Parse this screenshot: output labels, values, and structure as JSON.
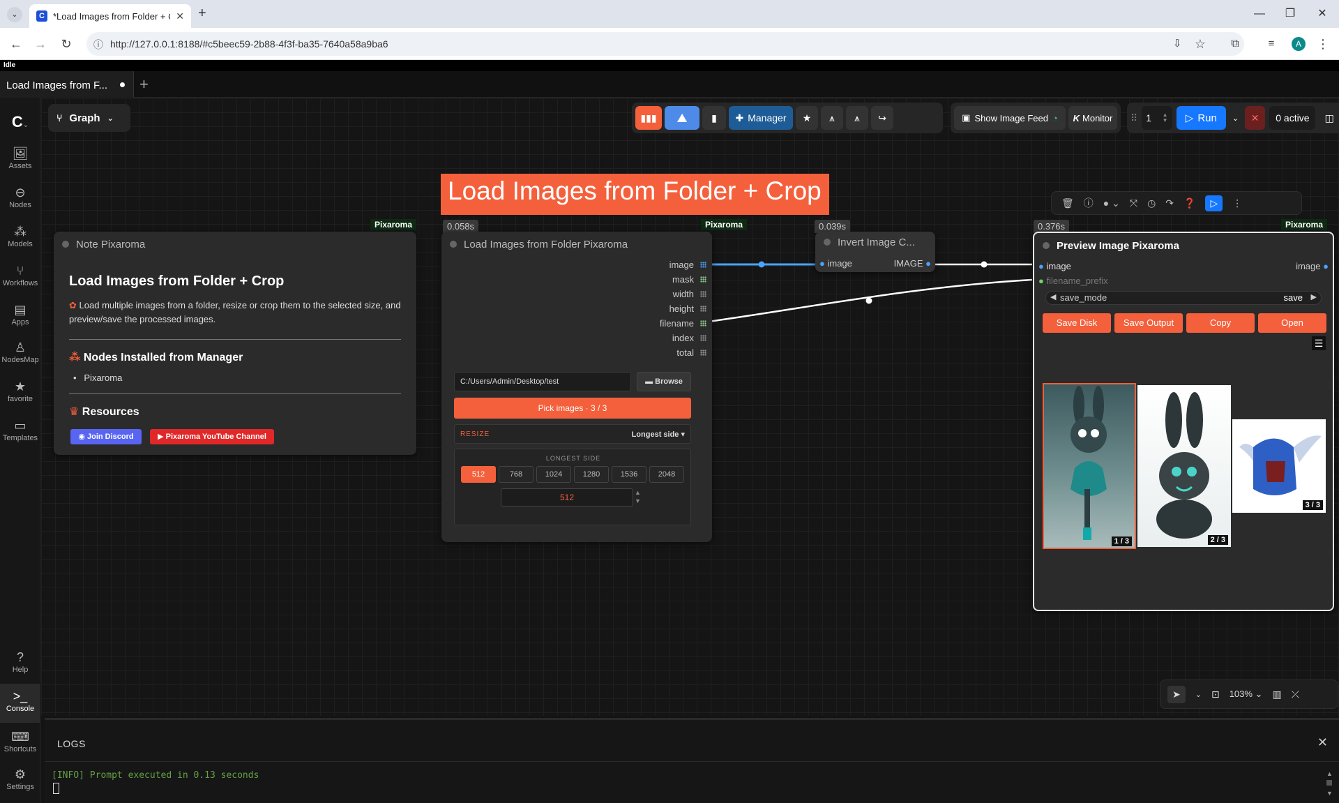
{
  "browser": {
    "tab_title": "*Load Images from Folder + Cr",
    "url": "http://127.0.0.1:8188/#c5beec59-2b88-4f3f-ba35-7640a58a9ba6",
    "profile_initial": "A"
  },
  "app": {
    "status": "Idle",
    "workflow_tab": "Load Images from F...",
    "graph_label": "Graph"
  },
  "sidebar": {
    "items": [
      {
        "label": "Assets",
        "icon": "image-icon"
      },
      {
        "label": "Nodes",
        "icon": "node-icon"
      },
      {
        "label": "Models",
        "icon": "models-icon"
      },
      {
        "label": "Workflows",
        "icon": "workflow-icon"
      },
      {
        "label": "Apps",
        "icon": "apps-icon"
      },
      {
        "label": "NodesMap",
        "icon": "nodesmap-icon"
      },
      {
        "label": "favorite",
        "icon": "star-icon"
      },
      {
        "label": "Templates",
        "icon": "templates-icon"
      }
    ],
    "bottom": [
      {
        "label": "Help",
        "icon": "help-icon"
      },
      {
        "label": "Console",
        "icon": "console-icon"
      },
      {
        "label": "Shortcuts",
        "icon": "keyboard-icon"
      },
      {
        "label": "Settings",
        "icon": "gear-icon"
      }
    ]
  },
  "toolbar": {
    "manager": "Manager",
    "show_image_feed": "Show Image Feed",
    "monitor": "Monitor",
    "batch_count": "1",
    "run": "Run",
    "active": "0 active"
  },
  "group_title": "Load Images from Folder + Crop",
  "note_node": {
    "badge": "Pixaroma",
    "title": "Note Pixaroma",
    "heading": "Load Images from Folder + Crop",
    "description": "Load multiple images from a folder, resize or crop them to the selected size, and preview/save the processed images.",
    "nodes_heading": "Nodes Installed from Manager",
    "nodes_list": [
      "Pixaroma"
    ],
    "resources_heading": "Resources",
    "discord_button": "Join Discord",
    "youtube_button": "Pixaroma YouTube Channel"
  },
  "load_node": {
    "time": "0.058s",
    "badge": "Pixaroma",
    "title": "Load Images from Folder Pixaroma",
    "outputs": [
      "image",
      "mask",
      "width",
      "height",
      "filename",
      "index",
      "total"
    ],
    "folder_path": "C:/Users/Admin/Desktop/test",
    "browse": "Browse",
    "pick_images": "Pick images · 3 / 3",
    "resize_label": "RESIZE",
    "resize_mode": "Longest side",
    "longest_side_label": "LONGEST SIDE",
    "sizes": [
      "512",
      "768",
      "1024",
      "1280",
      "1536",
      "2048"
    ],
    "selected_size": "512",
    "size_value": "512"
  },
  "invert_node": {
    "time": "0.039s",
    "title": "Invert Image C...",
    "input": "image",
    "output": "IMAGE"
  },
  "preview_node": {
    "time": "0.376s",
    "badge": "Pixaroma",
    "title": "Preview Image Pixaroma",
    "input_image": "image",
    "input_filename": "filename_prefix",
    "output_image": "image",
    "save_mode_label": "save_mode",
    "save_mode_value": "save",
    "buttons": [
      "Save Disk",
      "Save Output",
      "Copy",
      "Open"
    ],
    "thumb_labels": [
      "1 / 3",
      "2 / 3",
      "3 / 3"
    ]
  },
  "canvas_controls": {
    "zoom": "103%"
  },
  "logs": {
    "title": "LOGS",
    "line": "[INFO] Prompt executed in 0.13 seconds"
  },
  "colors": {
    "accent_orange": "#f4603c",
    "run_blue": "#1677ff",
    "link_blue": "#4aa3ff",
    "green_badge": "#0e2a12"
  }
}
